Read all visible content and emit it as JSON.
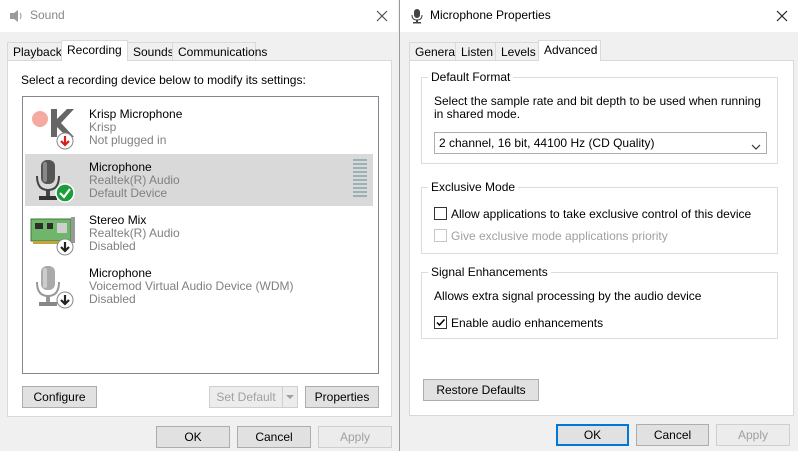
{
  "sound": {
    "title": "Sound",
    "tabs": [
      "Playback",
      "Recording",
      "Sounds",
      "Communications"
    ],
    "active_tab": "Recording",
    "instruction": "Select a recording device below to modify its settings:",
    "devices": [
      {
        "name": "Krisp Microphone",
        "driver": "Krisp",
        "status": "Not plugged in"
      },
      {
        "name": "Microphone",
        "driver": "Realtek(R) Audio",
        "status": "Default Device"
      },
      {
        "name": "Stereo Mix",
        "driver": "Realtek(R) Audio",
        "status": "Disabled"
      },
      {
        "name": "Microphone",
        "driver": "Voicemod Virtual Audio Device (WDM)",
        "status": "Disabled"
      }
    ],
    "configure_label": "Configure",
    "set_default_label": "Set Default",
    "properties_label": "Properties",
    "ok_label": "OK",
    "cancel_label": "Cancel",
    "apply_label": "Apply"
  },
  "props": {
    "title": "Microphone Properties",
    "tabs": [
      "General",
      "Listen",
      "Levels",
      "Advanced"
    ],
    "active_tab": "Advanced",
    "default_format": {
      "label": "Default Format",
      "description_line1": "Select the sample rate and bit depth to be used when running",
      "description_line2": "in shared mode.",
      "selected": "2 channel, 16 bit, 44100 Hz (CD Quality)"
    },
    "exclusive_mode": {
      "label": "Exclusive Mode",
      "allow_label": "Allow applications to take exclusive control of this device",
      "allow_checked": false,
      "priority_label": "Give exclusive mode applications priority",
      "priority_checked": false
    },
    "signal_enhancements": {
      "label": "Signal Enhancements",
      "description": "Allows extra signal processing by the audio device",
      "enable_label": "Enable audio enhancements",
      "enable_checked": true
    },
    "restore_label": "Restore Defaults",
    "ok_label": "OK",
    "cancel_label": "Cancel",
    "apply_label": "Apply"
  },
  "colors": {
    "accent": "#0078d7",
    "selection": "#d9d9d9",
    "ok_badge": "#1a9e3c",
    "down_badge": "#d42020"
  }
}
